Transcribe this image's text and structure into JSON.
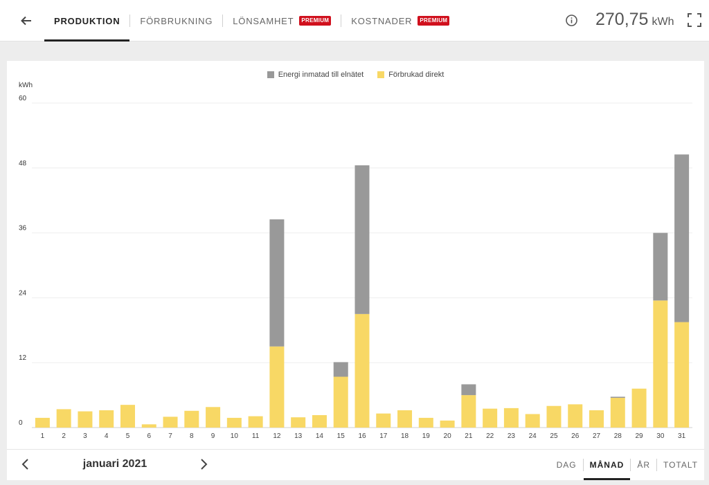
{
  "header": {
    "tabs": [
      {
        "label": "PRODUKTION",
        "active": true,
        "badge": ""
      },
      {
        "label": "FÖRBRUKNING",
        "active": false,
        "badge": ""
      },
      {
        "label": "LÖNSAMHET",
        "active": false,
        "badge": "PREMIUM"
      },
      {
        "label": "KOSTNADER",
        "active": false,
        "badge": "PREMIUM"
      }
    ],
    "total_value": "270,75",
    "total_unit": "kWh",
    "icons": {
      "back": "arrow-left-icon",
      "info": "info-icon",
      "fullscreen": "fullscreen-icon"
    }
  },
  "legend": [
    {
      "label": "Energi inmatad till elnätet",
      "color": "#999999"
    },
    {
      "label": "Förbrukad direkt",
      "color": "#f8d865"
    }
  ],
  "footer": {
    "period": "januari 2021",
    "ranges": [
      {
        "label": "DAG",
        "active": false
      },
      {
        "label": "MÅNAD",
        "active": true
      },
      {
        "label": "ÅR",
        "active": false
      },
      {
        "label": "TOTALT",
        "active": false
      }
    ]
  },
  "colors": {
    "badge": "#d0101d",
    "grid": "#eeeeee"
  },
  "chart_data": {
    "type": "bar",
    "stacked": true,
    "ylabel": "kWh",
    "ylim": [
      0,
      60
    ],
    "yticks": [
      0,
      12,
      24,
      36,
      48,
      60
    ],
    "grid": true,
    "legend_position": "top-center",
    "categories": [
      "1",
      "2",
      "3",
      "4",
      "5",
      "6",
      "7",
      "8",
      "9",
      "10",
      "11",
      "12",
      "13",
      "14",
      "15",
      "16",
      "17",
      "18",
      "19",
      "20",
      "21",
      "22",
      "23",
      "24",
      "25",
      "26",
      "27",
      "28",
      "29",
      "30",
      "31"
    ],
    "series": [
      {
        "name": "Förbrukad direkt",
        "color": "#f8d865",
        "values": [
          1.8,
          3.4,
          3.0,
          3.2,
          4.2,
          0.6,
          2.0,
          3.1,
          3.8,
          1.8,
          2.1,
          15.0,
          1.9,
          2.3,
          9.4,
          21.0,
          2.6,
          3.2,
          1.8,
          1.3,
          6.0,
          3.5,
          3.6,
          2.5,
          4.0,
          4.3,
          3.2,
          5.5,
          7.2,
          23.5,
          19.5
        ]
      },
      {
        "name": "Energi inmatad till elnätet",
        "color": "#999999",
        "values": [
          0,
          0,
          0,
          0,
          0,
          0,
          0,
          0,
          0,
          0,
          0,
          23.5,
          0,
          0,
          2.7,
          27.5,
          0,
          0,
          0,
          0,
          2.0,
          0,
          0,
          0,
          0,
          0,
          0,
          0.2,
          0,
          12.5,
          31.0
        ]
      }
    ]
  }
}
